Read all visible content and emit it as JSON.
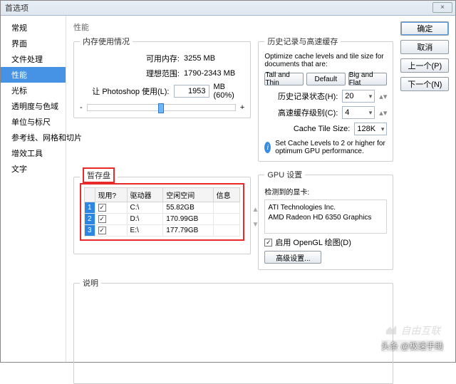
{
  "window": {
    "title": "首选项",
    "close": "×"
  },
  "sidebar": {
    "items": [
      "常规",
      "界面",
      "文件处理",
      "性能",
      "光标",
      "透明度与色域",
      "单位与标尺",
      "参考线、网格和切片",
      "增效工具",
      "文字"
    ],
    "selected_index": 3
  },
  "buttons": {
    "ok": "确定",
    "cancel": "取消",
    "prev": "上一个(P)",
    "next": "下一个(N)"
  },
  "main_title": "性能",
  "memory": {
    "legend": "内存使用情况",
    "available_label": "可用内存:",
    "available_value": "3255 MB",
    "ideal_label": "理想范围:",
    "ideal_value": "1790-2343 MB",
    "use_label": "让 Photoshop 使用(L):",
    "use_value": "1953",
    "use_unit": "MB (60%)",
    "minus": "-",
    "plus": "+"
  },
  "history": {
    "legend": "历史记录与高速缓存",
    "desc": "Optimize cache levels and tile size for documents that are:",
    "tall": "Tall and Thin",
    "default": "Default",
    "big": "Big and Flat",
    "states_label": "历史记录状态(H):",
    "states_value": "20",
    "levels_label": "高速缓存级别(C):",
    "levels_value": "4",
    "tile_label": "Cache Tile Size:",
    "tile_value": "128K",
    "info": "Set Cache Levels to 2 or higher for optimum GPU performance."
  },
  "scratch": {
    "legend": "暂存盘",
    "headers": [
      "现用?",
      "驱动器",
      "空闲空间",
      "信息"
    ],
    "rows": [
      {
        "idx": "1",
        "on": true,
        "drive": "C:\\",
        "free": "55.82GB",
        "info": ""
      },
      {
        "idx": "2",
        "on": true,
        "drive": "D:\\",
        "free": "170.99GB",
        "info": ""
      },
      {
        "idx": "3",
        "on": true,
        "drive": "E:\\",
        "free": "177.79GB",
        "info": ""
      }
    ]
  },
  "gpu": {
    "legend": "GPU 设置",
    "detected": "检测到的显卡:",
    "vendor": "ATI Technologies Inc.",
    "card": "AMD Radeon HD 6350 Graphics",
    "opengl": "启用 OpenGL 绘图(D)",
    "advanced": "高级设置..."
  },
  "desc": {
    "legend": "说明"
  },
  "watermark": "自由互联",
  "credit": "头条 @极速手助"
}
